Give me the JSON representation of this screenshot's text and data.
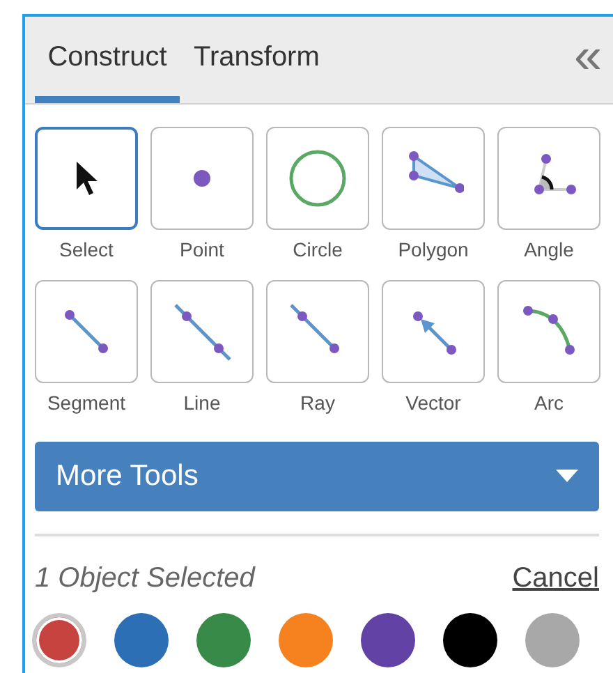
{
  "tabs": [
    {
      "label": "Construct",
      "selected": true
    },
    {
      "label": "Transform",
      "selected": false
    }
  ],
  "collapse": "«",
  "tools": [
    {
      "label": "Select",
      "kind": "select",
      "selected": true
    },
    {
      "label": "Point",
      "kind": "point",
      "selected": false
    },
    {
      "label": "Circle",
      "kind": "circle",
      "selected": false
    },
    {
      "label": "Polygon",
      "kind": "polygon",
      "selected": false
    },
    {
      "label": "Angle",
      "kind": "angle",
      "selected": false
    },
    {
      "label": "Segment",
      "kind": "segment",
      "selected": false
    },
    {
      "label": "Line",
      "kind": "line",
      "selected": false
    },
    {
      "label": "Ray",
      "kind": "ray",
      "selected": false
    },
    {
      "label": "Vector",
      "kind": "vector",
      "selected": false
    },
    {
      "label": "Arc",
      "kind": "arc",
      "selected": false
    }
  ],
  "more_tools": "More Tools",
  "selection_status": "1 Object Selected",
  "cancel": "Cancel",
  "colors": [
    {
      "color": "#c64340",
      "selected": true
    },
    {
      "color": "#2d6fb5",
      "selected": false
    },
    {
      "color": "#388a48",
      "selected": false
    },
    {
      "color": "#f6821f",
      "selected": false
    },
    {
      "color": "#6243a5",
      "selected": false
    },
    {
      "color": "#000000",
      "selected": false
    },
    {
      "color": "#a8a8a8",
      "selected": false
    }
  ]
}
